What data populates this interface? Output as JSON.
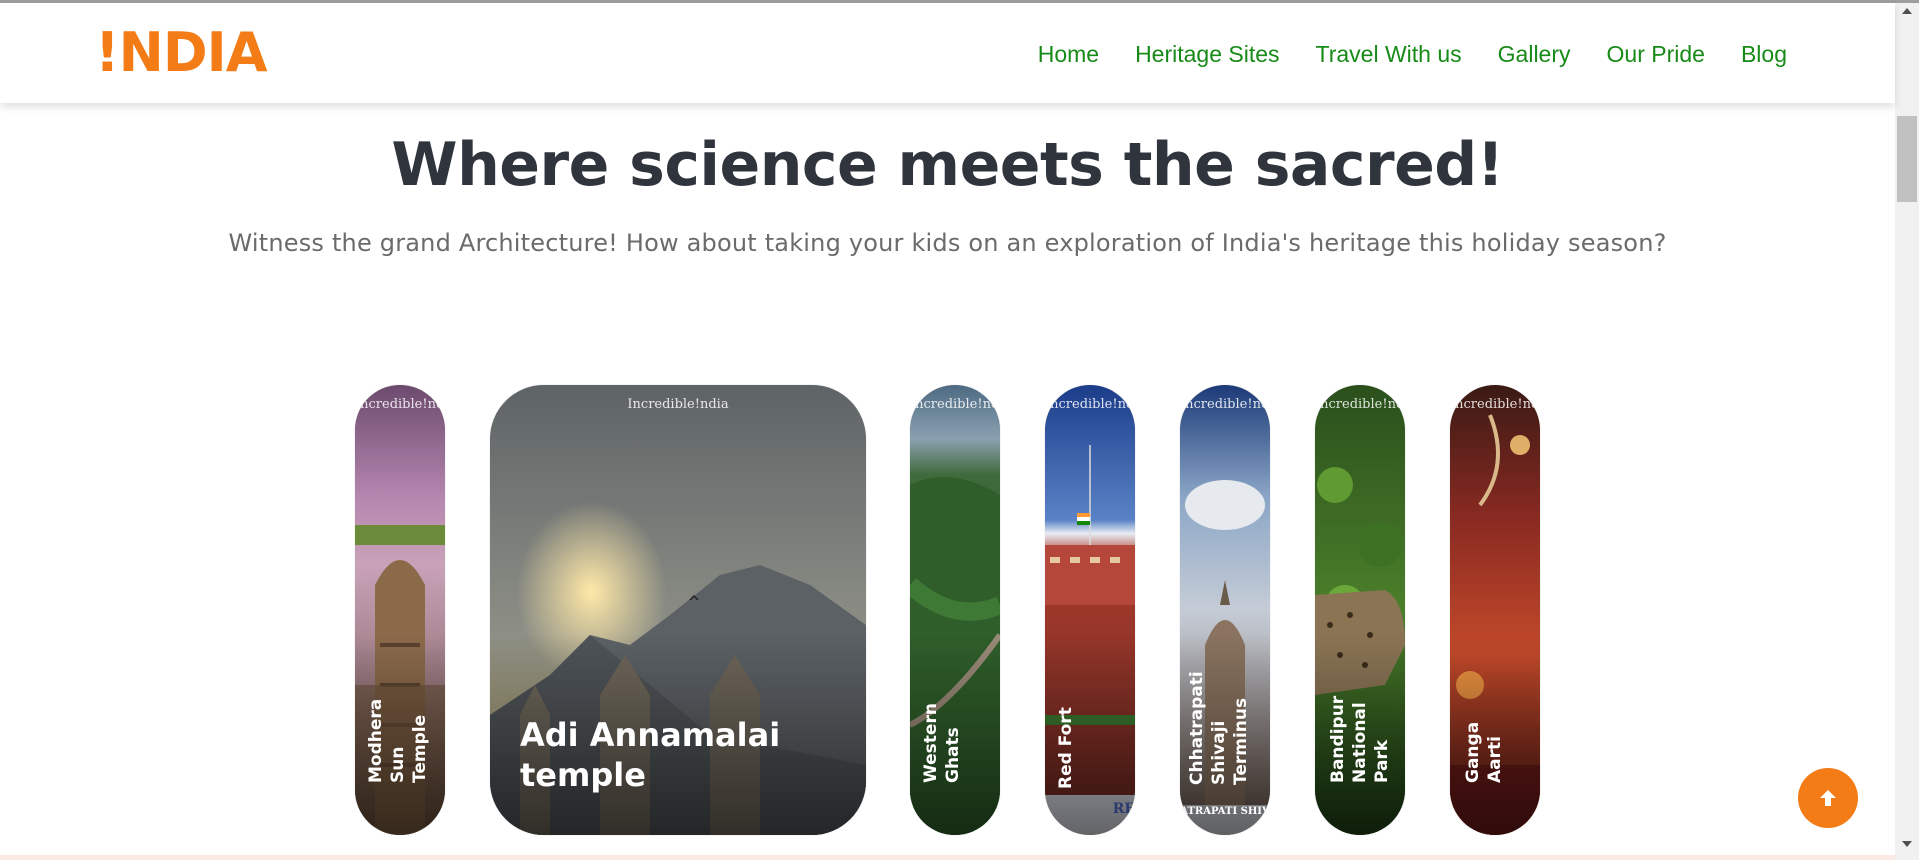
{
  "logo": {
    "text": "!NDIA",
    "color": "#f37c16"
  },
  "nav": {
    "items": [
      {
        "label": "Home"
      },
      {
        "label": "Heritage Sites"
      },
      {
        "label": "Travel With us"
      },
      {
        "label": "Gallery"
      },
      {
        "label": "Our Pride"
      },
      {
        "label": "Blog"
      }
    ],
    "color": "#178a17"
  },
  "hero": {
    "title": "Where science meets the sacred!",
    "subtitle": "Witness the grand Architecture! How about taking your kids on an exploration of India's heritage this holiday season?"
  },
  "cards": [
    {
      "label": "Modhera Sun Temple",
      "brand": "Incredible!ndia"
    },
    {
      "label": "Adi Annamalai temple",
      "brand": "Incredible!ndia"
    },
    {
      "label": "Western Ghats",
      "brand": "Incredible!ndia"
    },
    {
      "label": "Red Fort",
      "brand": "Incredible!ndia",
      "caption": "RE"
    },
    {
      "label": "Chhatrapati Shivaji Terminus",
      "brand": "Incredible!ndia",
      "caption": "ATRAPATI SHIV"
    },
    {
      "label": "Bandipur National Park",
      "brand": "Incredible!ndia"
    },
    {
      "label": "Ganga Aarti",
      "brand": "Incredible!ndia"
    }
  ],
  "icons": {
    "back_to_top": "arrow-up-icon"
  }
}
